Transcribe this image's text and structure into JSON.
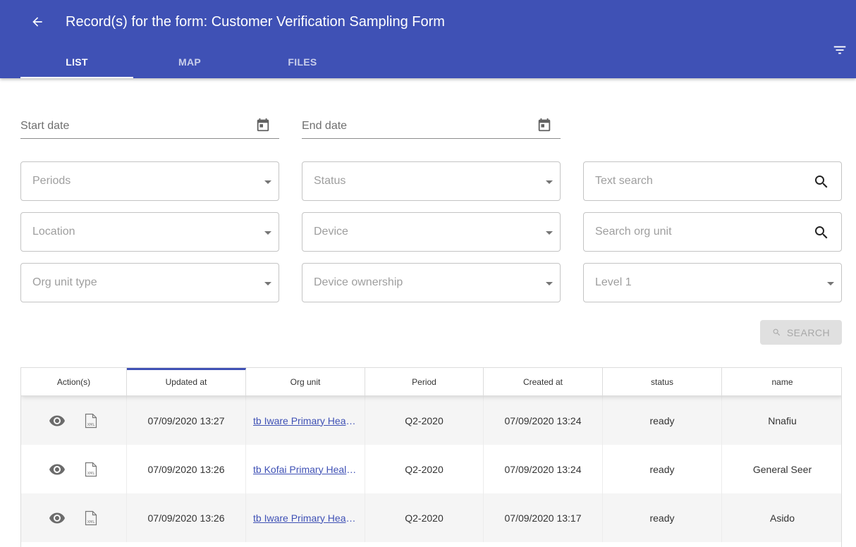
{
  "header": {
    "title": "Record(s) for the form: Customer Verification Sampling Form",
    "icons": {
      "back": "arrow-back-icon",
      "filter": "filter-list-icon"
    },
    "tabs": [
      {
        "label": "LIST",
        "active": true
      },
      {
        "label": "MAP",
        "active": false
      },
      {
        "label": "FILES",
        "active": false
      }
    ],
    "color": "#3f51b5"
  },
  "filters": {
    "start_date": {
      "label": "Start date"
    },
    "end_date": {
      "label": "End date"
    },
    "periods": {
      "placeholder": "Periods"
    },
    "status": {
      "placeholder": "Status"
    },
    "text_search": {
      "placeholder": "Text search"
    },
    "location": {
      "placeholder": "Location"
    },
    "device": {
      "placeholder": "Device"
    },
    "search_org_unit": {
      "placeholder": "Search org unit"
    },
    "org_unit_type": {
      "placeholder": "Org unit type"
    },
    "device_ownership": {
      "placeholder": "Device ownership"
    },
    "level": {
      "placeholder": "Level 1"
    },
    "search_button": {
      "label": "SEARCH",
      "disabled": true
    }
  },
  "table": {
    "columns": [
      "Action(s)",
      "Updated at",
      "Org unit",
      "Period",
      "Created at",
      "status",
      "name"
    ],
    "sorted_column": "Updated at",
    "rows": [
      {
        "updated_at": "07/09/2020 13:27",
        "org_unit": "tb Iware Primary Health Clinic",
        "period": "Q2-2020",
        "created_at": "07/09/2020 13:24",
        "status": "ready",
        "name": "Nnafiu"
      },
      {
        "updated_at": "07/09/2020 13:26",
        "org_unit": "tb Kofai Primary Health Clinic",
        "period": "Q2-2020",
        "created_at": "07/09/2020 13:24",
        "status": "ready",
        "name": "General Seer"
      },
      {
        "updated_at": "07/09/2020 13:26",
        "org_unit": "tb Iware Primary Health Clinic",
        "period": "Q2-2020",
        "created_at": "07/09/2020 13:17",
        "status": "ready",
        "name": "Asido"
      }
    ],
    "row_actions": [
      "eye-icon",
      "xml-file-icon"
    ]
  }
}
